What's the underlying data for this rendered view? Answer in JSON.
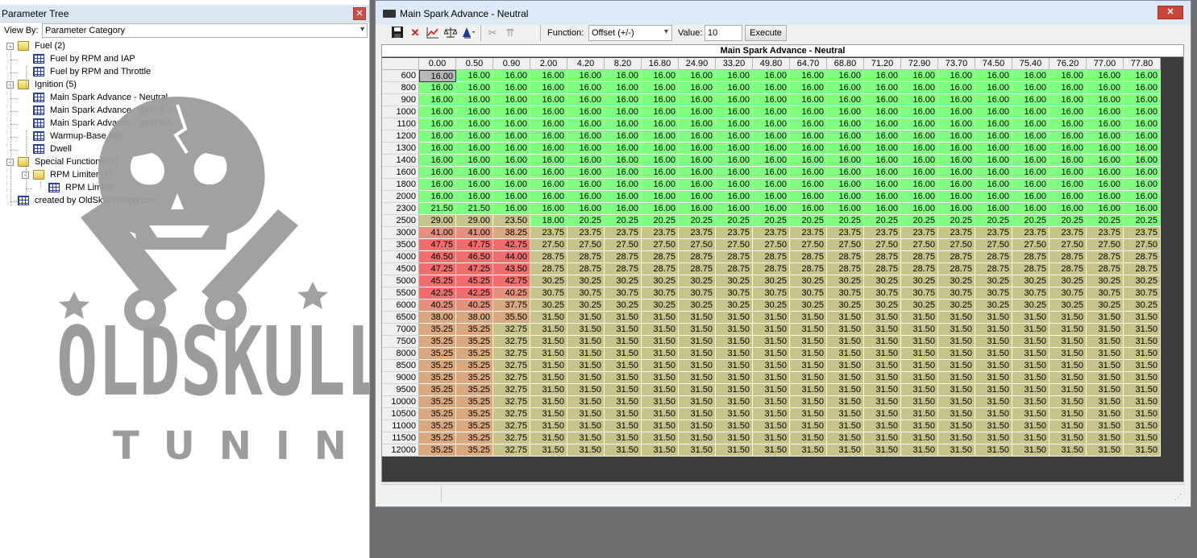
{
  "left_panel": {
    "title": "Parameter Tree",
    "view_by_label": "View By:",
    "view_by_value": "Parameter Category",
    "tree": [
      {
        "label": "Fuel (2)",
        "kind": "folder",
        "depth": 0,
        "expand": "-"
      },
      {
        "label": "Fuel by RPM and IAP",
        "kind": "table",
        "depth": 1
      },
      {
        "label": "Fuel by RPM and Throttle",
        "kind": "table",
        "depth": 1
      },
      {
        "label": "Ignition (5)",
        "kind": "folder",
        "depth": 0,
        "expand": "-"
      },
      {
        "label": "Main Spark Advance - Neutral",
        "kind": "table",
        "depth": 1
      },
      {
        "label": "Main Spark Advance - gear 1-2-3",
        "kind": "table",
        "depth": 1
      },
      {
        "label": "Main Spark Advance - gear 4-5",
        "kind": "table",
        "depth": 1
      },
      {
        "label": "Warmup-Base Idle",
        "kind": "table",
        "depth": 1
      },
      {
        "label": "Dwell",
        "kind": "table",
        "depth": 1
      },
      {
        "label": "Special Functions (1)",
        "kind": "folder",
        "depth": 0,
        "expand": "-"
      },
      {
        "label": "RPM Limiter (1)",
        "kind": "folder",
        "depth": 1,
        "expand": "-"
      },
      {
        "label": "RPM Limiter",
        "kind": "table",
        "depth": 2
      },
      {
        "label": "created by OldSkullTuning.com",
        "kind": "table",
        "depth": 0
      }
    ],
    "watermark_text_1": "OLDSKULL",
    "watermark_text_2": "TUNING"
  },
  "window": {
    "title": "Main Spark Advance - Neutral",
    "toolbar": {
      "icons": [
        "save-icon",
        "delete-icon",
        "graph-icon",
        "balance-icon",
        "fill-icon",
        "cut-icon",
        "interpolate-icon"
      ],
      "function_label": "Function:",
      "function_value": "Offset (+/-)",
      "value_label": "Value:",
      "value_input": "10",
      "execute_label": "Execute"
    },
    "table_title": "Main Spark Advance - Neutral",
    "colors": {
      "green": "#80ff80",
      "tan": "#c7c48b",
      "tan_light": "#d0c48a",
      "salmon_light": "#d9a87e",
      "salmon": "#e3917c",
      "red": "#f06e6e",
      "selected": "#b8b8b8"
    },
    "columns": [
      "0.00",
      "0.50",
      "0.90",
      "2.00",
      "4.20",
      "8.20",
      "16.80",
      "24.90",
      "33.20",
      "49.80",
      "64.70",
      "68.80",
      "71.20",
      "72.90",
      "73.70",
      "74.50",
      "75.40",
      "76.20",
      "77.00",
      "77.80"
    ],
    "rows": [
      {
        "rpm": "600",
        "head": [
          "16.00",
          "16.00",
          "16.00"
        ],
        "rest": "16.00"
      },
      {
        "rpm": "800",
        "head": [
          "16.00",
          "16.00",
          "16.00"
        ],
        "rest": "16.00"
      },
      {
        "rpm": "900",
        "head": [
          "16.00",
          "16.00",
          "16.00"
        ],
        "rest": "16.00"
      },
      {
        "rpm": "1000",
        "head": [
          "16.00",
          "16.00",
          "16.00"
        ],
        "rest": "16.00"
      },
      {
        "rpm": "1100",
        "head": [
          "16.00",
          "16.00",
          "16.00"
        ],
        "rest": "16.00"
      },
      {
        "rpm": "1200",
        "head": [
          "16.00",
          "16.00",
          "16.00"
        ],
        "rest": "16.00"
      },
      {
        "rpm": "1300",
        "head": [
          "16.00",
          "16.00",
          "16.00"
        ],
        "rest": "16.00"
      },
      {
        "rpm": "1400",
        "head": [
          "16.00",
          "16.00",
          "16.00"
        ],
        "rest": "16.00"
      },
      {
        "rpm": "1600",
        "head": [
          "16.00",
          "16.00",
          "16.00"
        ],
        "rest": "16.00"
      },
      {
        "rpm": "1800",
        "head": [
          "16.00",
          "16.00",
          "16.00"
        ],
        "rest": "16.00"
      },
      {
        "rpm": "2000",
        "head": [
          "16.00",
          "16.00",
          "16.00"
        ],
        "rest": "16.00"
      },
      {
        "rpm": "2300",
        "head": [
          "21.50",
          "21.50",
          "16.00"
        ],
        "rest": "16.00"
      },
      {
        "rpm": "2500",
        "head": [
          "29.00",
          "29.00",
          "23.50",
          "18.00"
        ],
        "rest": "20.25"
      },
      {
        "rpm": "3000",
        "head": [
          "41.00",
          "41.00",
          "38.25"
        ],
        "rest": "23.75"
      },
      {
        "rpm": "3500",
        "head": [
          "47.75",
          "47.75",
          "42.75"
        ],
        "rest": "27.50"
      },
      {
        "rpm": "4000",
        "head": [
          "46.50",
          "46.50",
          "44.00"
        ],
        "rest": "28.75"
      },
      {
        "rpm": "4500",
        "head": [
          "47.25",
          "47.25",
          "43.50"
        ],
        "rest": "28.75"
      },
      {
        "rpm": "5000",
        "head": [
          "45.25",
          "45.25",
          "42.75"
        ],
        "rest": "30.25"
      },
      {
        "rpm": "5500",
        "head": [
          "42.25",
          "42.25",
          "40.25"
        ],
        "rest": "30.75"
      },
      {
        "rpm": "6000",
        "head": [
          "40.25",
          "40.25",
          "37.75"
        ],
        "rest": "30.25"
      },
      {
        "rpm": "6500",
        "head": [
          "38.00",
          "38.00",
          "35.50"
        ],
        "rest": "31.50"
      },
      {
        "rpm": "7000",
        "head": [
          "35.25",
          "35.25",
          "32.75"
        ],
        "rest": "31.50"
      },
      {
        "rpm": "7500",
        "head": [
          "35.25",
          "35.25",
          "32.75"
        ],
        "rest": "31.50"
      },
      {
        "rpm": "8000",
        "head": [
          "35.25",
          "35.25",
          "32.75"
        ],
        "rest": "31.50"
      },
      {
        "rpm": "8500",
        "head": [
          "35.25",
          "35.25",
          "32.75"
        ],
        "rest": "31.50"
      },
      {
        "rpm": "9000",
        "head": [
          "35.25",
          "35.25",
          "32.75"
        ],
        "rest": "31.50"
      },
      {
        "rpm": "9500",
        "head": [
          "35.25",
          "35.25",
          "32.75"
        ],
        "rest": "31.50"
      },
      {
        "rpm": "10000",
        "head": [
          "35.25",
          "35.25",
          "32.75"
        ],
        "rest": "31.50"
      },
      {
        "rpm": "10500",
        "head": [
          "35.25",
          "35.25",
          "32.75"
        ],
        "rest": "31.50"
      },
      {
        "rpm": "11000",
        "head": [
          "35.25",
          "35.25",
          "32.75"
        ],
        "rest": "31.50"
      },
      {
        "rpm": "11500",
        "head": [
          "35.25",
          "35.25",
          "32.75"
        ],
        "rest": "31.50"
      },
      {
        "rpm": "12000",
        "head": [
          "35.25",
          "35.25",
          "32.75"
        ],
        "rest": "31.50"
      }
    ]
  }
}
